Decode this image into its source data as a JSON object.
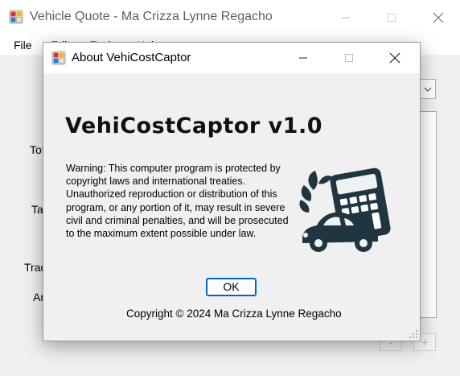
{
  "main_window": {
    "title": "Vehicle Quote - Ma Crizza Lynne Regacho",
    "menu": [
      "File",
      "Edit",
      "Tools",
      "Help"
    ],
    "labels": [
      "Tot",
      "Ta",
      "Trad",
      "Ar"
    ],
    "buttons": [
      "-",
      "+"
    ]
  },
  "about_dialog": {
    "title": "About VehiCostCaptor",
    "heading": "VehiCostCaptor v1.0",
    "warning": "Warning: This computer program is protected by copyright laws and international treaties. Unauthorized reproduction or distribution of this program, or any portion of it, may result in severe civil and criminal penalties, and will be prosecuted to the maximum extent possible under law.",
    "ok_label": "OK",
    "copyright": "Copyright © 2024 Ma Crizza Lynne Regacho",
    "logo_icon": "calculator-car-logo"
  },
  "colors": {
    "logo_dark": "#1f3540",
    "accent": "#0067c0",
    "dialog_bg": "#f0f0f0"
  }
}
